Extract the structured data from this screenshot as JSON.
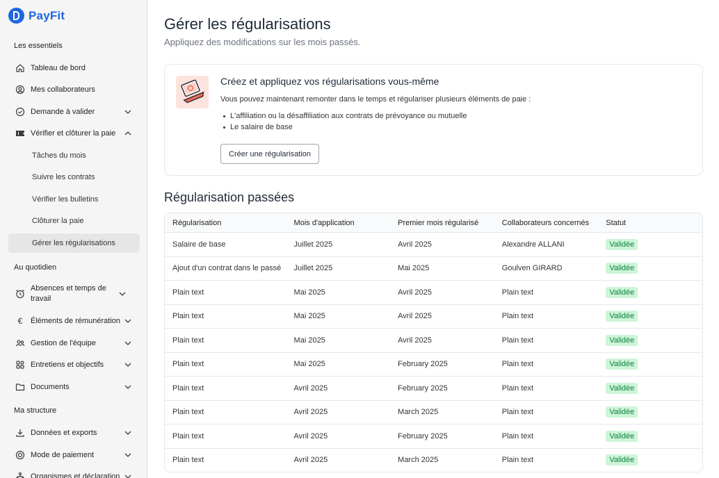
{
  "app": {
    "name": "PayFit"
  },
  "sidebar": {
    "sections": {
      "essentials": "Les essentiels",
      "daily": "Au quotidien",
      "structure": "Ma structure"
    },
    "items": {
      "dashboard": "Tableau de bord",
      "collaborators": "Mes collaborateurs",
      "requests": "Demande à valider",
      "verify": "Vérifier et clôturer la paie",
      "tasks": "Tâches du mois",
      "contracts": "Suivre les contrats",
      "payslips": "Vérifier les bulletins",
      "close": "Clôturer la paie",
      "regularisations": "Gérer les régularisations",
      "absences": "Absences et temps de travail",
      "remuneration": "Éléments de rémunération",
      "team": "Gestion de l'équipe",
      "interviews": "Entretiens et objectifs",
      "documents": "Documents",
      "data": "Données et exports",
      "payment": "Mode de paiement",
      "orgs": "Organismes et déclaration"
    }
  },
  "main": {
    "title": "Gérer les régularisations",
    "subtitle": "Appliquez des modifications sur les mois passés.",
    "card": {
      "title": "Créez et appliquez vos régularisations vous-même",
      "text": "Vous pouvez maintenant remonter dans le temps et régulariser plusieurs éléments de paie :",
      "bullets": [
        "L'affiliation ou la désaffiliation aux contrats de prévoyance ou mutuelle",
        "Le salaire de base"
      ],
      "button": "Créer une régularisation"
    },
    "past_title": "Régularisation passées",
    "table": {
      "headers": [
        "Régularisation",
        "Mois d'application",
        "Premier mois régularisé",
        "Collaborateurs concernés",
        "Statut"
      ],
      "rows": [
        [
          "Salaire de base",
          "Juillet 2025",
          "Avril 2025",
          "Alexandre ALLANI",
          "Validée"
        ],
        [
          "Ajout d'un contrat dans le passé",
          "Juillet 2025",
          "Mai 2025",
          "Goulven GIRARD",
          "Validée"
        ],
        [
          "Plain text",
          "Mai 2025",
          "Avril 2025",
          "Plain text",
          "Validée"
        ],
        [
          "Plain text",
          "Mai 2025",
          "Avril 2025",
          "Plain text",
          "Validée"
        ],
        [
          "Plain text",
          "Mai 2025",
          "Avril 2025",
          "Plain text",
          "Validée"
        ],
        [
          "Plain text",
          "Mai 2025",
          "February 2025",
          "Plain text",
          "Validée"
        ],
        [
          "Plain text",
          "Avril 2025",
          "February 2025",
          "Plain text",
          "Validée"
        ],
        [
          "Plain text",
          "Avril 2025",
          "March 2025",
          "Plain text",
          "Validée"
        ],
        [
          "Plain text",
          "Avril 2025",
          "February 2025",
          "Plain text",
          "Validée"
        ],
        [
          "Plain text",
          "Avril 2025",
          "March 2025",
          "Plain text",
          "Validée"
        ]
      ]
    }
  },
  "colors": {
    "brand": "#1f66e0",
    "status_bg": "#ccf5d9",
    "status_text": "#15803d"
  }
}
